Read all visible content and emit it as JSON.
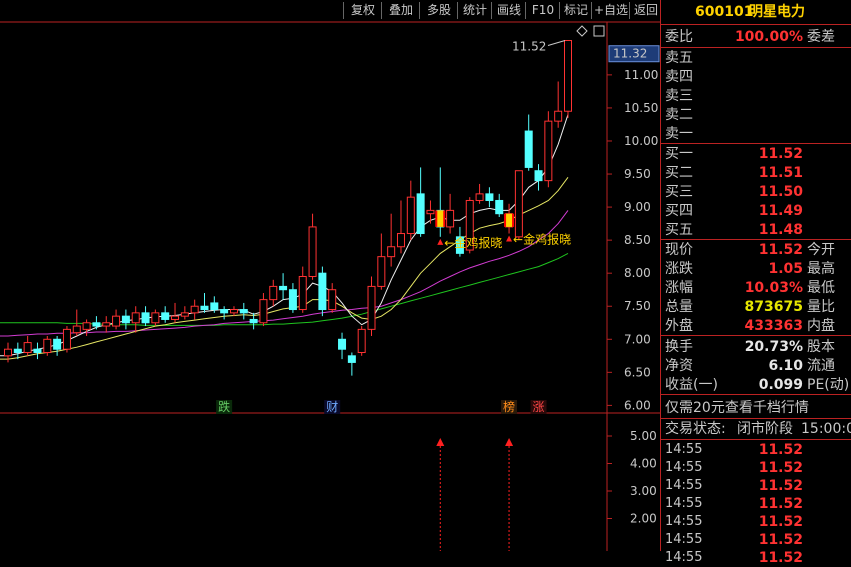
{
  "toolbar": {
    "buttons": [
      "复权",
      "叠加",
      "多股",
      "统计",
      "画线",
      "F10",
      "标记",
      "+自选",
      "返回"
    ]
  },
  "stock": {
    "code": "600101",
    "name": "明星电力"
  },
  "weibi": {
    "label": "委比",
    "value": "100.00%",
    "label2": "委差"
  },
  "sell": [
    {
      "label": "卖五"
    },
    {
      "label": "卖四"
    },
    {
      "label": "卖三"
    },
    {
      "label": "卖二"
    },
    {
      "label": "卖一"
    }
  ],
  "buy": [
    {
      "label": "买一",
      "price": "11.52"
    },
    {
      "label": "买二",
      "price": "11.51"
    },
    {
      "label": "买三",
      "price": "11.50"
    },
    {
      "label": "买四",
      "price": "11.49"
    },
    {
      "label": "买五",
      "price": "11.48"
    }
  ],
  "quote": [
    {
      "label": "现价",
      "value": "11.52",
      "label2": "今开",
      "color": "red"
    },
    {
      "label": "涨跌",
      "value": "1.05",
      "label2": "最高",
      "color": "red"
    },
    {
      "label": "涨幅",
      "value": "10.03%",
      "label2": "最低",
      "color": "red"
    },
    {
      "label": "总量",
      "value": "873675",
      "label2": "量比",
      "color": "yellow"
    },
    {
      "label": "外盘",
      "value": "433363",
      "label2": "内盘",
      "color": "red"
    }
  ],
  "fund": [
    {
      "label": "换手",
      "value": "20.73%",
      "label2": "股本"
    },
    {
      "label": "净资",
      "value": "6.10",
      "label2": "流通"
    },
    {
      "label": "收益(一)",
      "value": "0.099",
      "label2": "PE(动)"
    }
  ],
  "promo": "仅需20元查看千档行情",
  "status": {
    "label": "交易状态:",
    "state": "闭市阶段",
    "time": "15:00:0"
  },
  "ticks": [
    {
      "time": "14:55",
      "price": "11.52"
    },
    {
      "time": "14:55",
      "price": "11.52"
    },
    {
      "time": "14:55",
      "price": "11.52"
    },
    {
      "time": "14:55",
      "price": "11.52"
    },
    {
      "time": "14:55",
      "price": "11.52"
    },
    {
      "time": "14:55",
      "price": "11.52"
    },
    {
      "time": "14:55",
      "price": "11.52"
    }
  ],
  "chart_data": {
    "type": "candlestick",
    "y_ticks": [
      "11.00",
      "10.50",
      "10.00",
      "9.50",
      "9.00",
      "8.50",
      "8.00",
      "7.50",
      "7.00",
      "6.50",
      "6.00"
    ],
    "last_price_tag": "11.32",
    "high_label": "11.52",
    "ylim": [
      5.9,
      11.8
    ],
    "candles": [
      {
        "o": 6.75,
        "c": 6.85,
        "h": 6.95,
        "l": 6.65
      },
      {
        "o": 6.85,
        "c": 6.8,
        "h": 6.95,
        "l": 6.7
      },
      {
        "o": 6.8,
        "c": 6.95,
        "h": 7.05,
        "l": 6.75
      },
      {
        "o": 6.85,
        "c": 6.8,
        "h": 6.95,
        "l": 6.7
      },
      {
        "o": 6.8,
        "c": 7.0,
        "h": 7.05,
        "l": 6.75
      },
      {
        "o": 7.0,
        "c": 6.85,
        "h": 7.05,
        "l": 6.75
      },
      {
        "o": 6.85,
        "c": 7.15,
        "h": 7.2,
        "l": 6.8
      },
      {
        "o": 7.1,
        "c": 7.2,
        "h": 7.45,
        "l": 7.05
      },
      {
        "o": 7.15,
        "c": 7.25,
        "h": 7.3,
        "l": 7.05
      },
      {
        "o": 7.25,
        "c": 7.2,
        "h": 7.35,
        "l": 7.15
      },
      {
        "o": 7.2,
        "c": 7.25,
        "h": 7.35,
        "l": 7.1
      },
      {
        "o": 7.2,
        "c": 7.35,
        "h": 7.45,
        "l": 7.15
      },
      {
        "o": 7.35,
        "c": 7.25,
        "h": 7.45,
        "l": 7.15
      },
      {
        "o": 7.25,
        "c": 7.4,
        "h": 7.5,
        "l": 7.1
      },
      {
        "o": 7.4,
        "c": 7.25,
        "h": 7.5,
        "l": 7.2
      },
      {
        "o": 7.25,
        "c": 7.4,
        "h": 7.45,
        "l": 7.2
      },
      {
        "o": 7.4,
        "c": 7.3,
        "h": 7.5,
        "l": 7.25
      },
      {
        "o": 7.3,
        "c": 7.35,
        "h": 7.55,
        "l": 7.25
      },
      {
        "o": 7.35,
        "c": 7.4,
        "h": 7.5,
        "l": 7.3
      },
      {
        "o": 7.4,
        "c": 7.5,
        "h": 7.6,
        "l": 7.3
      },
      {
        "o": 7.5,
        "c": 7.45,
        "h": 7.7,
        "l": 7.4
      },
      {
        "o": 7.55,
        "c": 7.45,
        "h": 7.65,
        "l": 7.4
      },
      {
        "o": 7.45,
        "c": 7.4,
        "h": 7.5,
        "l": 7.3
      },
      {
        "o": 7.4,
        "c": 7.45,
        "h": 7.5,
        "l": 7.35
      },
      {
        "o": 7.45,
        "c": 7.4,
        "h": 7.55,
        "l": 7.3
      },
      {
        "o": 7.3,
        "c": 7.25,
        "h": 7.4,
        "l": 7.15
      },
      {
        "o": 7.25,
        "c": 7.6,
        "h": 7.7,
        "l": 7.2
      },
      {
        "o": 7.6,
        "c": 7.8,
        "h": 7.9,
        "l": 7.5
      },
      {
        "o": 7.8,
        "c": 7.75,
        "h": 8.0,
        "l": 7.6
      },
      {
        "o": 7.75,
        "c": 7.45,
        "h": 7.85,
        "l": 7.4
      },
      {
        "o": 7.45,
        "c": 7.95,
        "h": 8.1,
        "l": 7.4
      },
      {
        "o": 7.95,
        "c": 8.7,
        "h": 8.9,
        "l": 7.9
      },
      {
        "o": 8.0,
        "c": 7.45,
        "h": 8.1,
        "l": 7.35
      },
      {
        "o": 7.45,
        "c": 7.75,
        "h": 7.85,
        "l": 7.4
      },
      {
        "o": 7.0,
        "c": 6.85,
        "h": 7.1,
        "l": 6.7
      },
      {
        "o": 6.75,
        "c": 6.65,
        "h": 6.8,
        "l": 6.45
      },
      {
        "o": 6.8,
        "c": 7.15,
        "h": 7.2,
        "l": 6.75
      },
      {
        "o": 7.15,
        "c": 7.8,
        "h": 7.95,
        "l": 7.05
      },
      {
        "o": 7.8,
        "c": 8.25,
        "h": 8.6,
        "l": 7.75
      },
      {
        "o": 8.25,
        "c": 8.4,
        "h": 8.9,
        "l": 8.1
      },
      {
        "o": 8.4,
        "c": 8.6,
        "h": 9.1,
        "l": 8.3
      },
      {
        "o": 8.6,
        "c": 9.15,
        "h": 9.4,
        "l": 8.5
      },
      {
        "o": 9.2,
        "c": 8.6,
        "h": 9.6,
        "l": 8.55
      },
      {
        "o": 8.9,
        "c": 8.95,
        "h": 9.1,
        "l": 8.75
      },
      {
        "o": 8.95,
        "c": 8.7,
        "h": 9.6,
        "l": 8.55
      },
      {
        "o": 8.7,
        "c": 8.95,
        "h": 9.2,
        "l": 8.6
      },
      {
        "o": 8.55,
        "c": 8.3,
        "h": 8.7,
        "l": 8.25
      },
      {
        "o": 8.35,
        "c": 9.1,
        "h": 9.15,
        "l": 8.3
      },
      {
        "o": 9.1,
        "c": 9.2,
        "h": 9.35,
        "l": 9.05
      },
      {
        "o": 9.2,
        "c": 9.1,
        "h": 9.3,
        "l": 9.0
      },
      {
        "o": 9.1,
        "c": 8.9,
        "h": 9.2,
        "l": 8.85
      },
      {
        "o": 8.7,
        "c": 8.9,
        "h": 9.05,
        "l": 8.6
      },
      {
        "o": 8.55,
        "c": 9.55,
        "h": 9.55,
        "l": 8.5
      },
      {
        "o": 10.15,
        "c": 9.6,
        "h": 10.4,
        "l": 9.55
      },
      {
        "o": 9.55,
        "c": 9.4,
        "h": 9.65,
        "l": 9.25
      },
      {
        "o": 9.4,
        "c": 10.3,
        "h": 10.45,
        "l": 9.3
      },
      {
        "o": 10.3,
        "c": 10.45,
        "h": 10.9,
        "l": 10.2
      },
      {
        "o": 10.45,
        "c": 11.52,
        "h": 11.52,
        "l": 10.35
      }
    ],
    "ma5": [
      6.75,
      6.78,
      6.82,
      6.85,
      6.88,
      6.92,
      6.98,
      7.05,
      7.12,
      7.18,
      7.22,
      7.25,
      7.28,
      7.3,
      7.32,
      7.34,
      7.35,
      7.36,
      7.38,
      7.4,
      7.42,
      7.44,
      7.45,
      7.45,
      7.44,
      7.38,
      7.42,
      7.5,
      7.6,
      7.62,
      7.68,
      7.85,
      7.8,
      7.72,
      7.55,
      7.35,
      7.22,
      7.3,
      7.55,
      7.9,
      8.2,
      8.5,
      8.7,
      8.8,
      8.85,
      8.8,
      8.8,
      8.9,
      8.95,
      8.98,
      8.95,
      8.95,
      9.1,
      9.3,
      9.4,
      9.6,
      9.95,
      10.4
    ],
    "ma10": [
      6.7,
      6.72,
      6.75,
      6.78,
      6.8,
      6.82,
      6.85,
      6.88,
      6.92,
      6.96,
      7.0,
      7.04,
      7.08,
      7.12,
      7.16,
      7.2,
      7.22,
      7.25,
      7.27,
      7.29,
      7.31,
      7.33,
      7.35,
      7.36,
      7.37,
      7.36,
      7.38,
      7.42,
      7.46,
      7.48,
      7.5,
      7.6,
      7.6,
      7.58,
      7.5,
      7.4,
      7.32,
      7.3,
      7.35,
      7.45,
      7.6,
      7.8,
      8.0,
      8.15,
      8.3,
      8.4,
      8.5,
      8.6,
      8.68,
      8.72,
      8.75,
      8.8,
      8.88,
      8.95,
      9.02,
      9.1,
      9.25,
      9.45
    ],
    "ma20": [
      7.05,
      7.06,
      7.07,
      7.08,
      7.08,
      7.09,
      7.09,
      7.1,
      7.1,
      7.11,
      7.11,
      7.12,
      7.12,
      7.13,
      7.14,
      7.15,
      7.16,
      7.17,
      7.18,
      7.2,
      7.21,
      7.22,
      7.24,
      7.25,
      7.26,
      7.27,
      7.28,
      7.29,
      7.31,
      7.33,
      7.35,
      7.38,
      7.4,
      7.42,
      7.44,
      7.45,
      7.47,
      7.48,
      7.5,
      7.55,
      7.6,
      7.66,
      7.72,
      7.8,
      7.88,
      7.95,
      8.02,
      8.08,
      8.13,
      8.18,
      8.22,
      8.27,
      8.33,
      8.4,
      8.5,
      8.6,
      8.75,
      8.95
    ],
    "ma60": [
      7.25,
      7.25,
      7.25,
      7.25,
      7.25,
      7.25,
      7.24,
      7.24,
      7.24,
      7.23,
      7.23,
      7.22,
      7.22,
      7.22,
      7.21,
      7.21,
      7.21,
      7.21,
      7.21,
      7.21,
      7.21,
      7.21,
      7.22,
      7.22,
      7.22,
      7.22,
      7.22,
      7.23,
      7.23,
      7.24,
      7.25,
      7.26,
      7.28,
      7.3,
      7.32,
      7.35,
      7.38,
      7.42,
      7.46,
      7.5,
      7.54,
      7.58,
      7.62,
      7.66,
      7.7,
      7.74,
      7.78,
      7.82,
      7.86,
      7.9,
      7.94,
      7.98,
      8.02,
      8.06,
      8.1,
      8.16,
      8.22,
      8.3
    ],
    "markers": [
      {
        "text": "跌",
        "index": 22,
        "color": "#64c864",
        "bg": "#0a2a0a"
      },
      {
        "text": "财",
        "index": 33,
        "color": "#6fa8ff",
        "bg": "#0a0a2a"
      },
      {
        "text": "榜",
        "index": 51,
        "color": "#ff8c1a",
        "bg": "#2a1a0a"
      },
      {
        "text": "涨",
        "index": 54,
        "color": "#ff4646",
        "bg": "#2a0a0a"
      }
    ],
    "signals": [
      {
        "index": 44,
        "text": "←金鸡报晓",
        "vol_arrow": true
      },
      {
        "index": 51,
        "text": "←金鸡报晓",
        "vol_arrow": true
      }
    ],
    "volume_axis": [
      "5.00",
      "4.00",
      "3.00",
      "2.00"
    ]
  }
}
